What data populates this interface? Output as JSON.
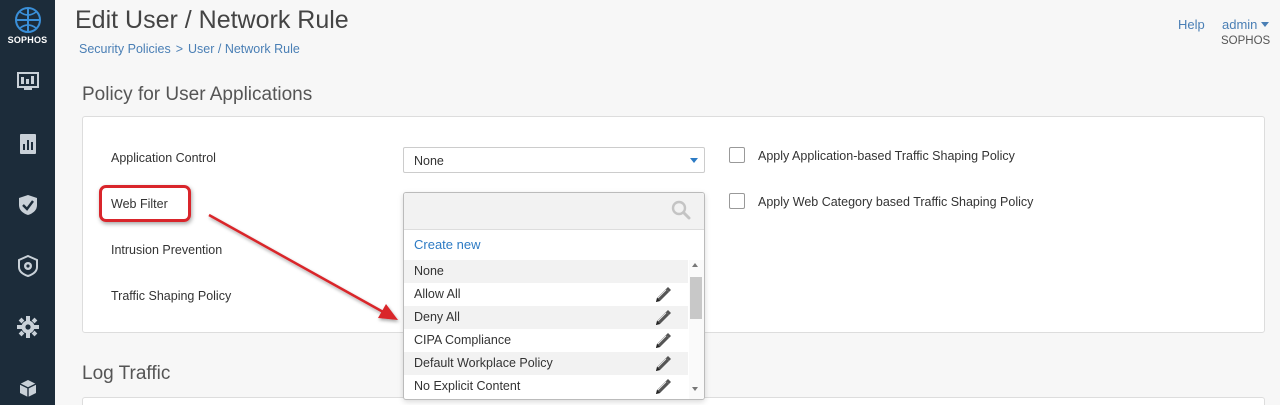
{
  "brand": {
    "logo_text": "SOPHOS",
    "sidebar_bg": "#1c2c3a",
    "accent": "#2d7bc4"
  },
  "sidebar": {
    "items": [
      {
        "icon": "monitor-icon"
      },
      {
        "icon": "report-icon"
      },
      {
        "icon": "shield-check-icon"
      },
      {
        "icon": "shield-gear-icon"
      },
      {
        "icon": "gear-icon"
      },
      {
        "icon": "box-icon"
      }
    ]
  },
  "header": {
    "title": "Edit User / Network Rule",
    "breadcrumb": [
      "Security Policies",
      ">",
      "User / Network Rule"
    ],
    "help": "Help",
    "user": "admin",
    "org": "SOPHOS"
  },
  "sections": {
    "apps_heading": "Policy for User Applications",
    "log_heading": "Log Traffic"
  },
  "fields": {
    "application_control": {
      "label": "Application Control",
      "value": "None"
    },
    "web_filter": {
      "label": "Web Filter"
    },
    "intrusion_prevention": {
      "label": "Intrusion Prevention"
    },
    "traffic_shaping": {
      "label": "Traffic Shaping Policy"
    }
  },
  "checkboxes": {
    "app_shaping": "Apply Application-based Traffic Shaping Policy",
    "web_shaping": "Apply Web Category based Traffic Shaping Policy"
  },
  "dropdown": {
    "search_placeholder": "",
    "create_new": "Create new",
    "options": [
      {
        "label": "None",
        "editable": false
      },
      {
        "label": "Allow All",
        "editable": true
      },
      {
        "label": "Deny All",
        "editable": true
      },
      {
        "label": "CIPA Compliance",
        "editable": true
      },
      {
        "label": "Default Workplace Policy",
        "editable": true
      },
      {
        "label": "No Explicit Content",
        "editable": true
      }
    ]
  },
  "annotation": {
    "highlight_color": "#d9252b"
  }
}
